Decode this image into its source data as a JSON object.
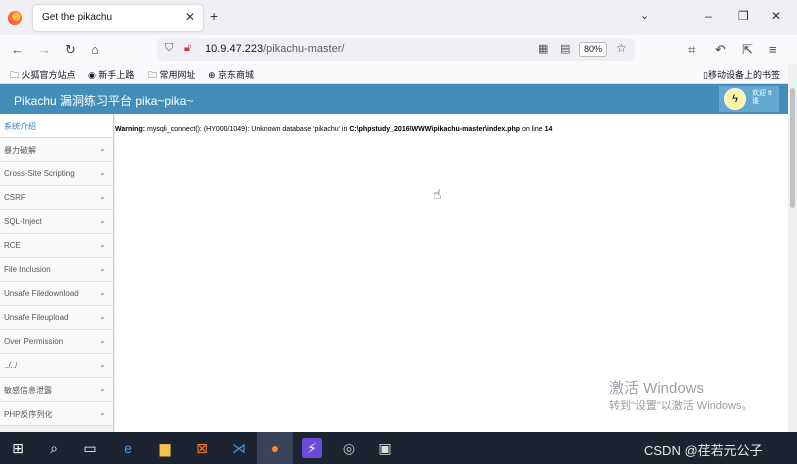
{
  "browser": {
    "tab_title": "Get the pikachu",
    "url_host": "10.9.47.223",
    "url_path": "/pikachu-master/",
    "zoom": "80%",
    "bookmarks": [
      "火狐官方站点",
      "新手上路",
      "常用网址",
      "京东商城"
    ],
    "mobile_bookmarks": "移动设备上的书签"
  },
  "app": {
    "title": "Pikachu 漏洞练习平台 pika~pika~",
    "welcome": "欢迎 tt谁"
  },
  "sidebar": {
    "items": [
      {
        "label": "系统介绍"
      },
      {
        "label": "暴力破解"
      },
      {
        "label": "Cross-Site Scripting"
      },
      {
        "label": "CSRF"
      },
      {
        "label": "SQL-Inject"
      },
      {
        "label": "RCE"
      },
      {
        "label": "File Inclusion"
      },
      {
        "label": "Unsafe Filedownload"
      },
      {
        "label": "Unsafe Fileupload"
      },
      {
        "label": "Over Permission"
      },
      {
        "label": "../../"
      },
      {
        "label": "敏感信息泄露"
      },
      {
        "label": "PHP反序列化"
      }
    ]
  },
  "main": {
    "warning_label": "Warning:",
    "warning_text": " mysqli_connect(): (HY000/1049): Unknown database 'pikachu' in ",
    "warning_path": "C:\\phpstudy_2016\\WWW\\pikachu-master\\index.php",
    "warning_line_text": " on line ",
    "warning_line": "14"
  },
  "watermark": {
    "line1": "激活 Windows",
    "line2": "转到\"设置\"以激活 Windows。"
  },
  "taskbar": {
    "csdn": "CSDN @荏若元公子"
  },
  "colors": {
    "header": "#438eb9",
    "taskbar": "#1c2431"
  }
}
